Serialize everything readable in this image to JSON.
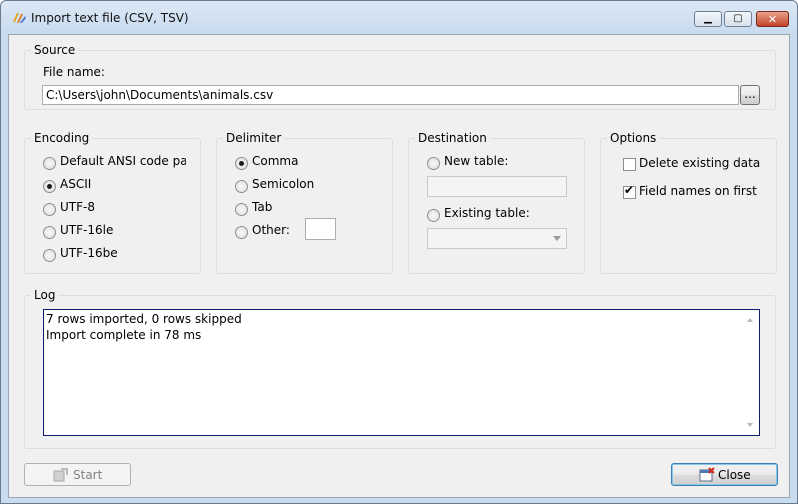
{
  "window": {
    "title": "Import text file (CSV, TSV)"
  },
  "source": {
    "group_label": "Source",
    "file_label": "File name:",
    "file_value": "C:\\Users\\john\\Documents\\animals.csv",
    "browse_label": "..."
  },
  "encoding": {
    "group_label": "Encoding",
    "options": [
      "Default ANSI code page",
      "ASCII",
      "UTF-8",
      "UTF-16le",
      "UTF-16be"
    ],
    "selected": "ASCII"
  },
  "delimiter": {
    "group_label": "Delimiter",
    "options": [
      "Comma",
      "Semicolon",
      "Tab",
      "Other:"
    ],
    "selected": "Comma",
    "other_value": ""
  },
  "destination": {
    "group_label": "Destination",
    "new_table_label": "New table:",
    "new_table_value": "",
    "existing_table_label": "Existing table:",
    "existing_table_value": ""
  },
  "options": {
    "group_label": "Options",
    "delete_existing_label": "Delete existing data",
    "delete_existing_checked": false,
    "field_names_label": "Field names on first row",
    "field_names_checked": true
  },
  "log": {
    "group_label": "Log",
    "lines": [
      "7 rows imported, 0 rows skipped",
      "Import complete in 78 ms"
    ]
  },
  "footer": {
    "start_label": "Start",
    "close_label": "Close"
  }
}
